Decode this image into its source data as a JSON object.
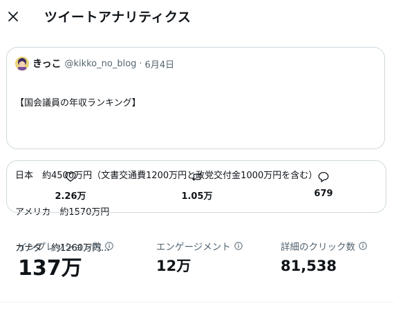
{
  "header": {
    "title": "ツイートアナリティクス",
    "close_icon": "close-icon"
  },
  "tweet": {
    "author_name": "きっこ",
    "handle": "@kikko_no_blog",
    "separator": "·",
    "date": "6月4日",
    "lines": [
      "【国会議員の年収ランキング】",
      "",
      "日本　約4500万円（文書交通費1200万円と政党交付金1000万円を含む）",
      "アメリカ　約1570万円",
      "カナダ　約1260万円..."
    ]
  },
  "engagement": {
    "likes": "2.26万",
    "retweets": "1.05万",
    "replies": "679",
    "icons": [
      "heart-icon",
      "retweet-icon",
      "reply-icon"
    ]
  },
  "stats": {
    "impressions": {
      "label": "インプレッション数",
      "value": "137万"
    },
    "engagements": {
      "label": "エンゲージメント",
      "value": "12万"
    },
    "detail_clicks": {
      "label": "詳細のクリック数",
      "value": "81,538"
    }
  },
  "colors": {
    "text": "#0f1419",
    "secondary": "#536471",
    "border": "#cfd9de"
  }
}
